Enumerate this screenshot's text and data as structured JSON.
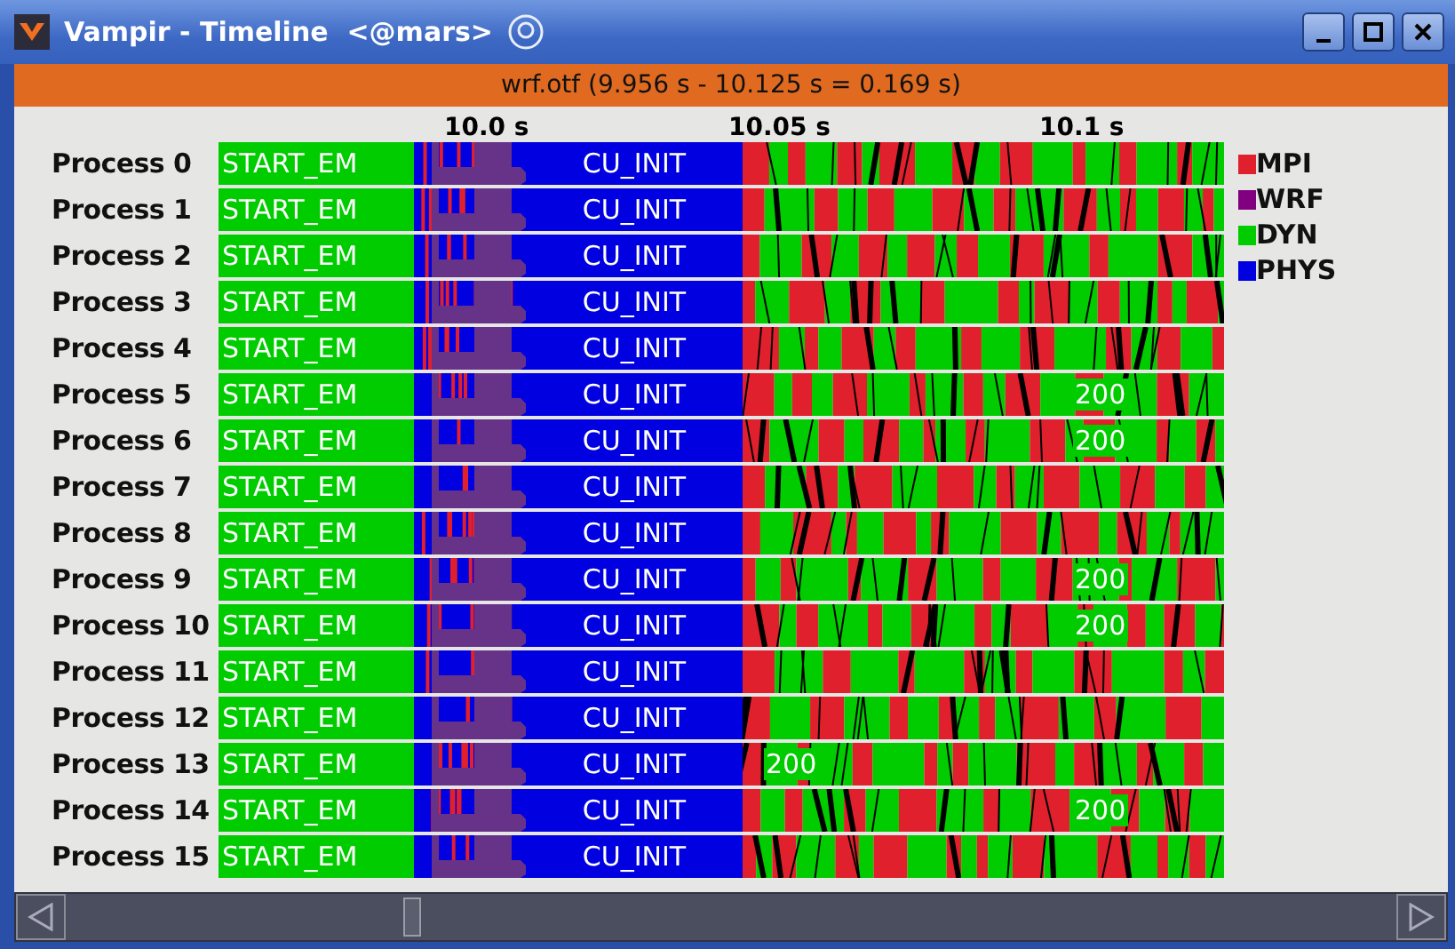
{
  "window": {
    "title": "Vampir - Timeline  <@mars>"
  },
  "trace": {
    "title": "wrf.otf (9.956 s - 10.125 s = 0.169 s)"
  },
  "axis": {
    "ticks": [
      "10.0 s",
      "10.05 s",
      "10.1 s"
    ]
  },
  "processes": [
    {
      "name": "Process 0",
      "bars": [
        {
          "label": "START_EM",
          "color": "#00cc00"
        },
        {
          "label": "CU_INIT",
          "color": "#0000e0"
        }
      ]
    },
    {
      "name": "Process 1",
      "bars": [
        {
          "label": "START_EM",
          "color": "#00cc00"
        },
        {
          "label": "CU_INIT",
          "color": "#0000e0"
        }
      ]
    },
    {
      "name": "Process 2",
      "bars": [
        {
          "label": "START_EM",
          "color": "#00cc00"
        },
        {
          "label": "CU_INIT",
          "color": "#0000e0"
        }
      ]
    },
    {
      "name": "Process 3",
      "bars": [
        {
          "label": "START_EM",
          "color": "#00cc00"
        },
        {
          "label": "CU_INIT",
          "color": "#0000e0"
        }
      ]
    },
    {
      "name": "Process 4",
      "bars": [
        {
          "label": "START_EM",
          "color": "#00cc00"
        },
        {
          "label": "CU_INIT",
          "color": "#0000e0"
        }
      ]
    },
    {
      "name": "Process 5",
      "bars": [
        {
          "label": "START_EM",
          "color": "#00cc00"
        },
        {
          "label": "CU_INIT",
          "color": "#0000e0"
        }
      ],
      "marker": {
        "text": "200",
        "kind": "late"
      }
    },
    {
      "name": "Process 6",
      "bars": [
        {
          "label": "START_EM",
          "color": "#00cc00"
        },
        {
          "label": "CU_INIT",
          "color": "#0000e0"
        }
      ],
      "marker": {
        "text": "200",
        "kind": "late"
      }
    },
    {
      "name": "Process 7",
      "bars": [
        {
          "label": "START_EM",
          "color": "#00cc00"
        },
        {
          "label": "CU_INIT",
          "color": "#0000e0"
        }
      ]
    },
    {
      "name": "Process 8",
      "bars": [
        {
          "label": "START_EM",
          "color": "#00cc00"
        },
        {
          "label": "CU_INIT",
          "color": "#0000e0"
        }
      ]
    },
    {
      "name": "Process 9",
      "bars": [
        {
          "label": "START_EM",
          "color": "#00cc00"
        },
        {
          "label": "CU_INIT",
          "color": "#0000e0"
        }
      ],
      "marker": {
        "text": "200",
        "kind": "late"
      }
    },
    {
      "name": "Process 10",
      "bars": [
        {
          "label": "START_EM",
          "color": "#00cc00"
        },
        {
          "label": "CU_INIT",
          "color": "#0000e0"
        }
      ],
      "marker": {
        "text": "200",
        "kind": "late"
      }
    },
    {
      "name": "Process 11",
      "bars": [
        {
          "label": "START_EM",
          "color": "#00cc00"
        },
        {
          "label": "CU_INIT",
          "color": "#0000e0"
        }
      ]
    },
    {
      "name": "Process 12",
      "bars": [
        {
          "label": "START_EM",
          "color": "#00cc00"
        },
        {
          "label": "CU_INIT",
          "color": "#0000e0"
        }
      ]
    },
    {
      "name": "Process 13",
      "bars": [
        {
          "label": "START_EM",
          "color": "#00cc00"
        },
        {
          "label": "CU_INIT",
          "color": "#0000e0"
        }
      ],
      "marker": {
        "text": "200",
        "kind": "early"
      }
    },
    {
      "name": "Process 14",
      "bars": [
        {
          "label": "START_EM",
          "color": "#00cc00"
        },
        {
          "label": "CU_INIT",
          "color": "#0000e0"
        }
      ],
      "marker": {
        "text": "200",
        "kind": "late"
      }
    },
    {
      "name": "Process 15",
      "bars": [
        {
          "label": "START_EM",
          "color": "#00cc00"
        },
        {
          "label": "CU_INIT",
          "color": "#0000e0"
        }
      ]
    }
  ],
  "legend": [
    {
      "label": "MPI",
      "color": "#e0202c"
    },
    {
      "label": "WRF",
      "color": "#800080"
    },
    {
      "label": "DYN",
      "color": "#00cc00"
    },
    {
      "label": "PHYS",
      "color": "#0000e0"
    }
  ]
}
